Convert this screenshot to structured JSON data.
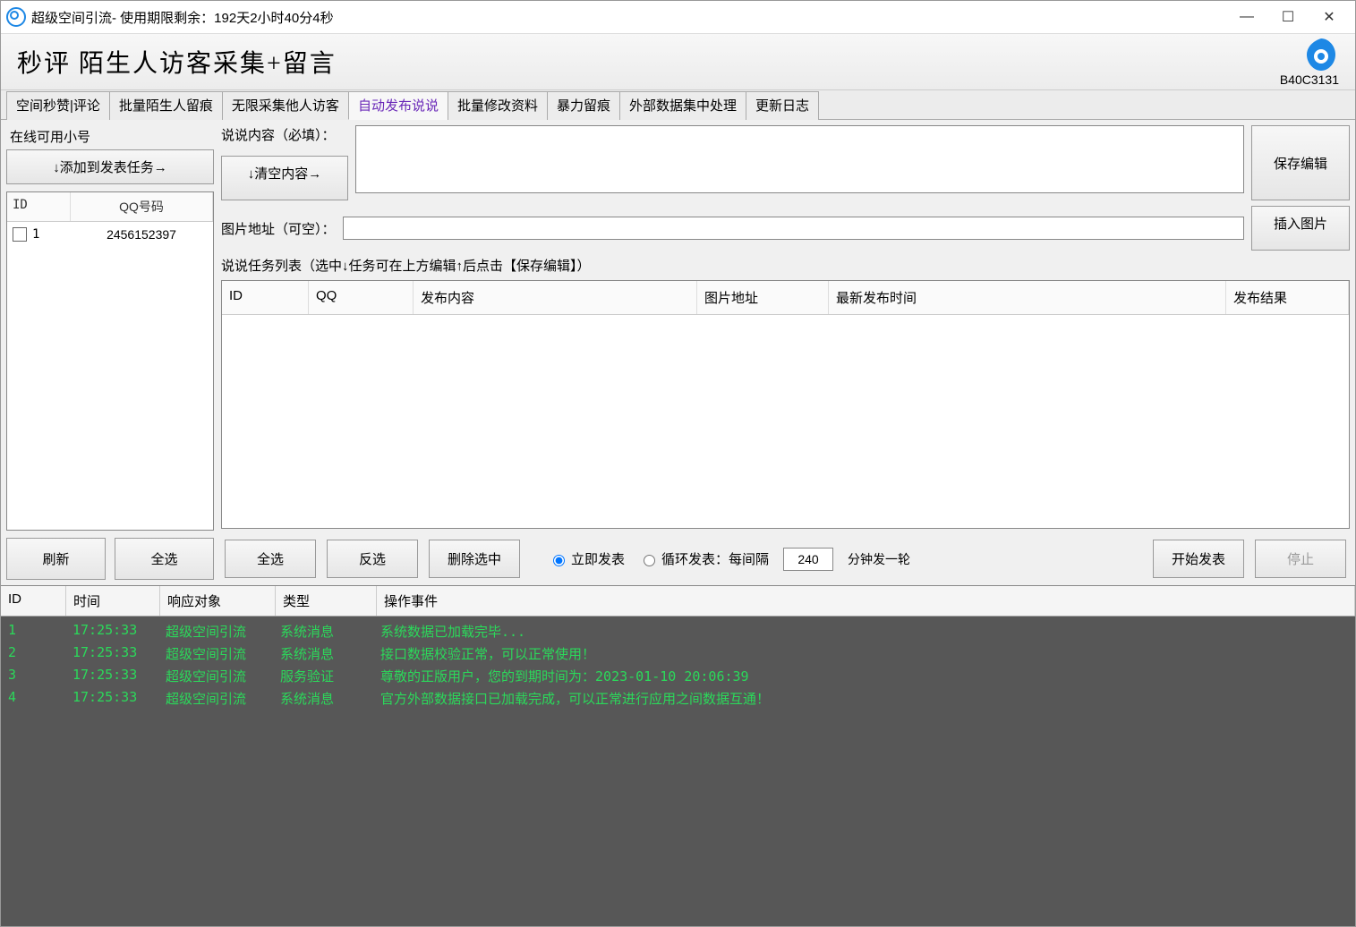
{
  "window": {
    "app_name": "超级空间引流",
    "title_suffix": " - 使用期限剩余：192天2小时40分4秒"
  },
  "banner": {
    "title": "秒评 陌生人访客采集+留言",
    "code": "B40C3131"
  },
  "tabs": [
    "空间秒赞|评论",
    "批量陌生人留痕",
    "无限采集他人访客",
    "自动发布说说",
    "批量修改资料",
    "暴力留痕",
    "外部数据集中处理",
    "更新日志"
  ],
  "active_tab_index": 3,
  "left": {
    "group_label": "在线可用小号",
    "add_task_btn": "↓添加到发表任务→",
    "header_id": "ID",
    "header_qq": "QQ号码",
    "accounts": [
      {
        "id": "1",
        "qq": "2456152397"
      }
    ],
    "refresh_btn": "刷新",
    "select_all_btn": "全选"
  },
  "right": {
    "content_label": "说说内容（必填）：",
    "clear_btn": "↓清空内容→",
    "save_btn": "保存编辑",
    "img_label": "图片地址（可空）：",
    "insert_btn": "插入图片",
    "task_list_label": "说说任务列表（选中↓任务可在上方编辑↑后点击【保存编辑】）",
    "task_headers": {
      "id": "ID",
      "qq": "QQ",
      "content": "发布内容",
      "img": "图片地址",
      "time": "最新发布时间",
      "result": "发布结果"
    },
    "bottom": {
      "select_all": "全选",
      "invert": "反选",
      "delete": "删除选中",
      "radio_now": "立即发表",
      "radio_loop_prefix": "循环发表：每间隔",
      "interval_value": "240",
      "radio_loop_suffix": "分钟发一轮",
      "start": "开始发表",
      "stop": "停止"
    }
  },
  "log": {
    "headers": {
      "id": "ID",
      "time": "时间",
      "obj": "响应对象",
      "type": "类型",
      "event": "操作事件"
    },
    "rows": [
      {
        "id": "1",
        "time": "17:25:33",
        "obj": "超级空间引流",
        "type": "系统消息",
        "event": "系统数据已加载完毕..."
      },
      {
        "id": "2",
        "time": "17:25:33",
        "obj": "超级空间引流",
        "type": "系统消息",
        "event": "接口数据校验正常，可以正常使用！"
      },
      {
        "id": "3",
        "time": "17:25:33",
        "obj": "超级空间引流",
        "type": "服务验证",
        "event": "尊敬的正版用户，您的到期时间为：2023-01-10 20:06:39"
      },
      {
        "id": "4",
        "time": "17:25:33",
        "obj": "超级空间引流",
        "type": "系统消息",
        "event": "官方外部数据接口已加载完成，可以正常进行应用之间数据互通！"
      }
    ]
  }
}
